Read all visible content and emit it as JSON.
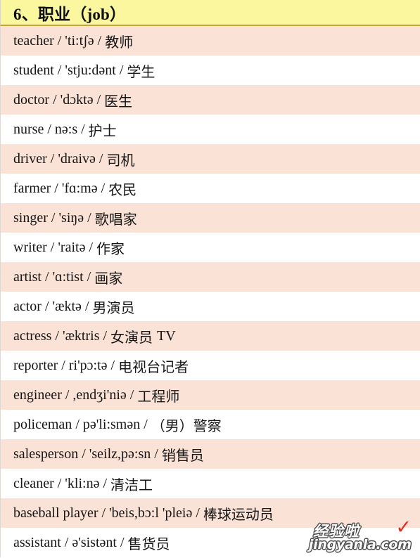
{
  "header": {
    "number": "6",
    "title": "6、职业（job）",
    "background_color": "#faf79e",
    "rule_color": "#c9a43a"
  },
  "colors": {
    "row_tint": "#fbe2d6",
    "row_plain": "#ffffff",
    "text": "#161616",
    "watermark_check": "#e8271d"
  },
  "list": {
    "separator": "/",
    "rows": [
      {
        "word": "teacher",
        "ipa": "'ti:tʃə",
        "zh": "教师",
        "extra": ""
      },
      {
        "word": "student",
        "ipa": "'stju:dənt",
        "zh": "学生",
        "extra": ""
      },
      {
        "word": "doctor",
        "ipa": "'dɔktə",
        "zh": "医生",
        "extra": ""
      },
      {
        "word": "nurse",
        "ipa": "nə:s",
        "zh": "护士",
        "extra": ""
      },
      {
        "word": "driver",
        "ipa": "'draivə",
        "zh": "司机",
        "extra": ""
      },
      {
        "word": "farmer",
        "ipa": "'fɑ:mə",
        "zh": "农民",
        "extra": ""
      },
      {
        "word": "singer",
        "ipa": "'siŋə",
        "zh": "歌唱家",
        "extra": ""
      },
      {
        "word": "writer",
        "ipa": "'raitə",
        "zh": "作家",
        "extra": ""
      },
      {
        "word": "artist",
        "ipa": "'ɑ:tist",
        "zh": "画家",
        "extra": ""
      },
      {
        "word": "actor",
        "ipa": "'æktə",
        "zh": "男演员",
        "extra": ""
      },
      {
        "word": "actress",
        "ipa": "'æktris",
        "zh": "女演员",
        "extra": "TV"
      },
      {
        "word": "reporter",
        "ipa": "ri'pɔ:tə",
        "zh": "电视台记者",
        "extra": ""
      },
      {
        "word": "engineer",
        "ipa": ",endʒi'niə",
        "zh": "工程师",
        "extra": ""
      },
      {
        "word": "policeman",
        "ipa": "pə'li:smən",
        "zh": "（男）警察",
        "extra": ""
      },
      {
        "word": "salesperson",
        "ipa": "'seilz,pə:sn",
        "zh": "销售员",
        "extra": ""
      },
      {
        "word": "cleaner",
        "ipa": "'kli:nə",
        "zh": "清洁工",
        "extra": ""
      },
      {
        "word": "baseball player",
        "ipa": "'beis,bɔ:l 'pleiə",
        "zh": "棒球运动员",
        "extra": ""
      },
      {
        "word": "assistant",
        "ipa": "ə'sistənt",
        "zh": "售货员",
        "extra": ""
      }
    ]
  },
  "watermark": {
    "brand_cn": "经验啦",
    "check_glyph": "✓",
    "url": "jingyanla.com"
  }
}
